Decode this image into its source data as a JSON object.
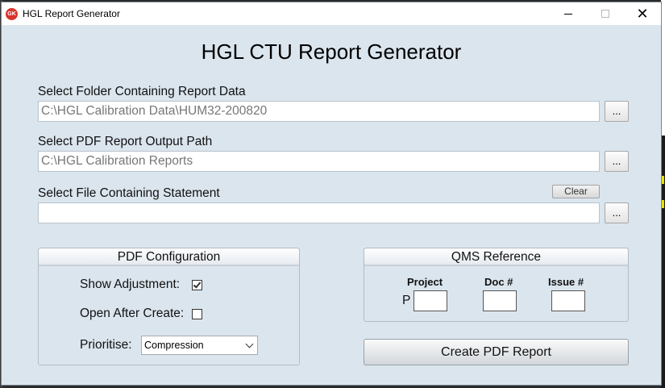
{
  "window": {
    "title": "HGL Report Generator",
    "icon_text": "GK",
    "close_glyph": "✕"
  },
  "app_title": "HGL CTU Report Generator",
  "report_data": {
    "label": "Select Folder Containing Report Data",
    "path": "C:\\HGL Calibration Data\\HUM32-200820",
    "browse_label": "..."
  },
  "output_path": {
    "label": "Select PDF Report Output Path",
    "path": "C:\\HGL Calibration Reports",
    "browse_label": "..."
  },
  "statement": {
    "label": "Select File Containing Statement",
    "path": "",
    "clear_label": "Clear",
    "browse_label": "..."
  },
  "pdf_config": {
    "title": "PDF Configuration",
    "show_adjustment_label": "Show Adjustment:",
    "show_adjustment_checked": true,
    "open_after_label": "Open After Create:",
    "open_after_checked": false,
    "prioritise_label": "Prioritise:",
    "prioritise_value": "Compression"
  },
  "qms": {
    "title": "QMS Reference",
    "project_label": "Project",
    "project_prefix": "P",
    "doc_label": "Doc #",
    "issue_label": "Issue #"
  },
  "create_button_label": "Create PDF Report",
  "colors": {
    "close_icon_bg": "#d9342b",
    "window_bg": "#dbe5ee"
  }
}
